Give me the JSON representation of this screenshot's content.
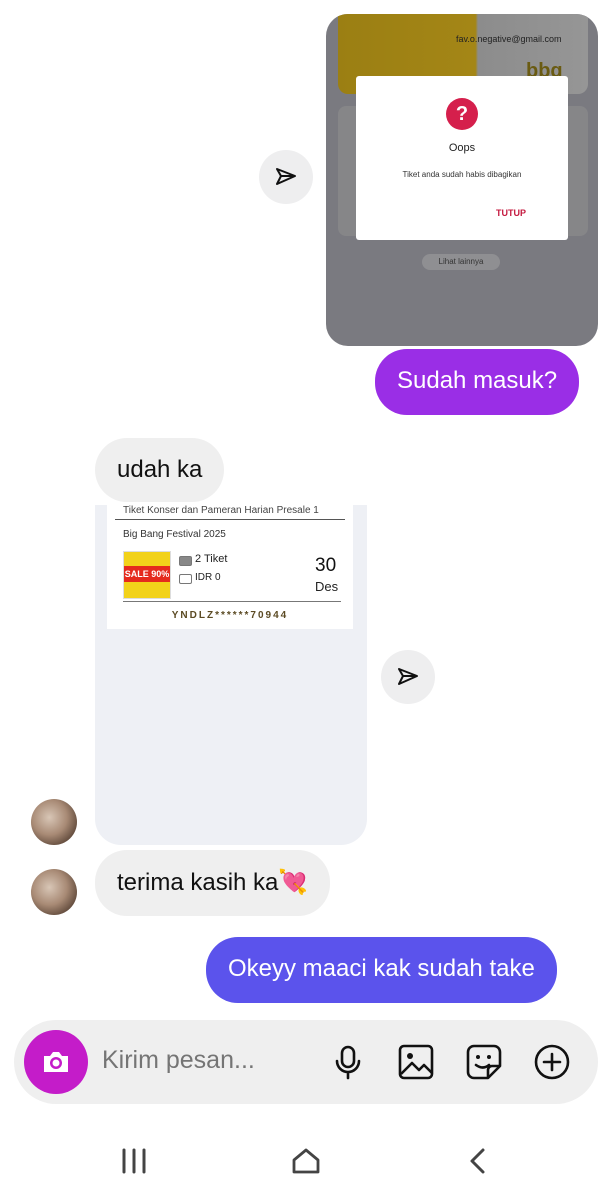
{
  "shared_screenshot": {
    "email": "fav.o.negative@gmail.com",
    "brand": "bbq",
    "dialog": {
      "icon_glyph": "?",
      "title": "Oops",
      "message": "Tiket anda sudah habis dibagikan",
      "button": "TUTUP"
    },
    "lihat_lainnya": "Lihat lainnya"
  },
  "messages": {
    "out_1": "Sudah masuk?",
    "in_1": "udah ka",
    "in_2": "terima kasih ka💘",
    "out_2": "Okeyy maaci kak sudah take"
  },
  "ticket": {
    "header": "Tiket Konser dan Pameran Harian Presale 1",
    "event": "Big Bang Festival 2025",
    "image_text": "SALE 90%",
    "quantity": "2 Tiket",
    "price": "IDR 0",
    "day": "30",
    "month": "Des",
    "code": "YNDLZ******70944"
  },
  "composer": {
    "placeholder": "Kirim pesan...",
    "icons": [
      "camera-icon",
      "microphone-icon",
      "gallery-icon",
      "sticker-icon",
      "plus-icon"
    ]
  },
  "nav": {
    "icons": [
      "recents-icon",
      "home-icon",
      "back-icon"
    ]
  },
  "colors": {
    "outgoing_purple": "#9a2ee6",
    "outgoing_blue": "#5b53ec",
    "incoming": "#efefef",
    "camera": "#c41cc9",
    "oops_red": "#d51f4c"
  }
}
